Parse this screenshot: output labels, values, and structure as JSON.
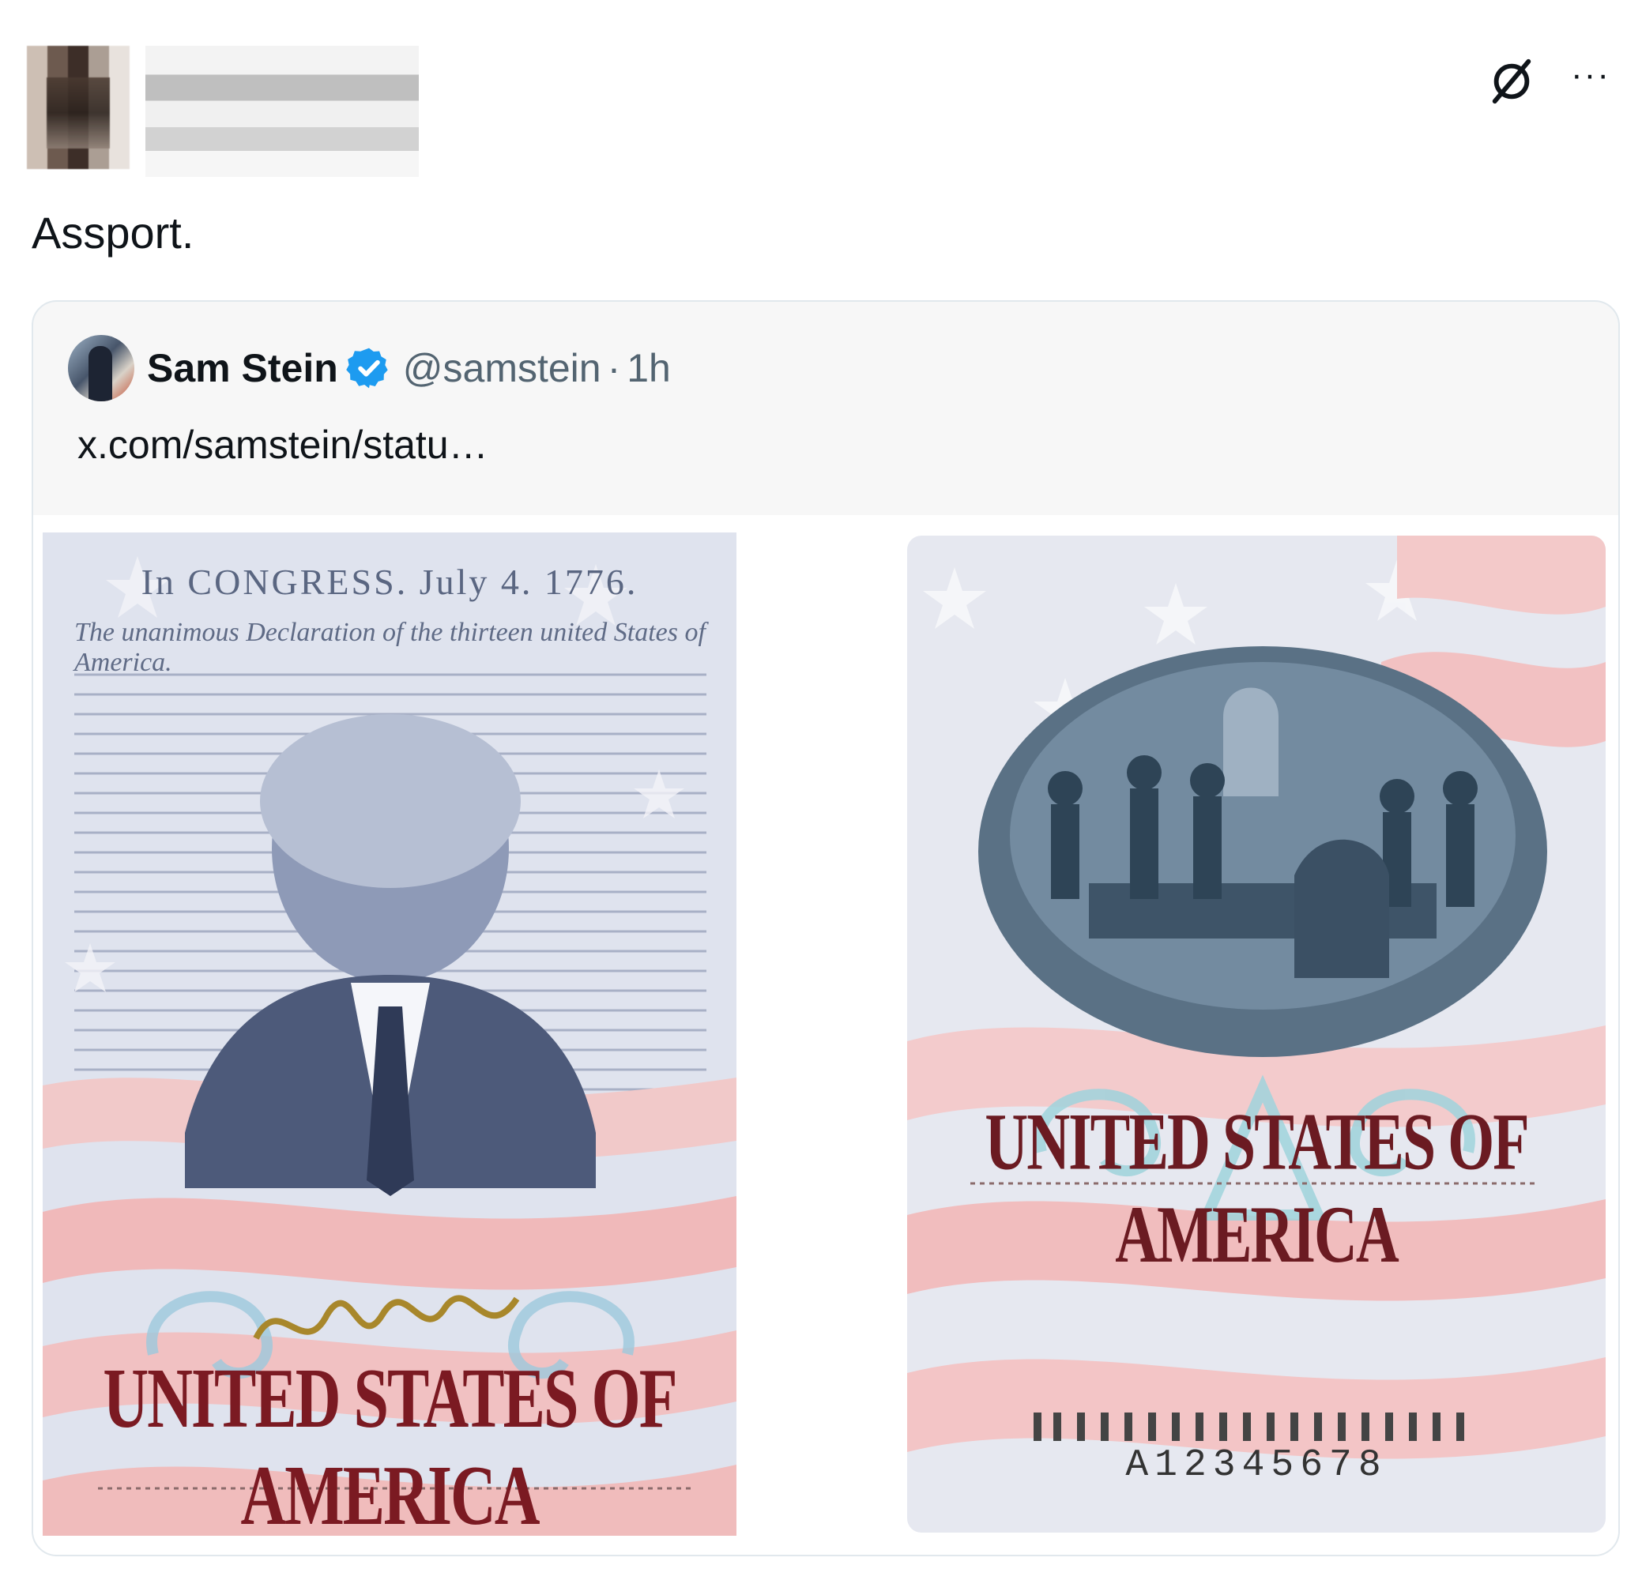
{
  "header": {
    "icons": [
      "grok-icon",
      "more-icon"
    ],
    "more_label": "···"
  },
  "tweet": {
    "text": "Assport."
  },
  "quote": {
    "name": "Sam Stein",
    "handle": "@samstein",
    "separator": "·",
    "time": "1h",
    "link": "x.com/samstein/statu…",
    "verified_color": "#1d9bf0"
  },
  "images": {
    "left": {
      "congress": "In CONGRESS. July 4. 1776.",
      "declaration": "The unanimous Declaration of the thirteen united States of America.",
      "country": "UNITED STATES OF AMERICA"
    },
    "right": {
      "country": "UNITED STATES OF AMERICA",
      "serial": "A12345678"
    }
  }
}
